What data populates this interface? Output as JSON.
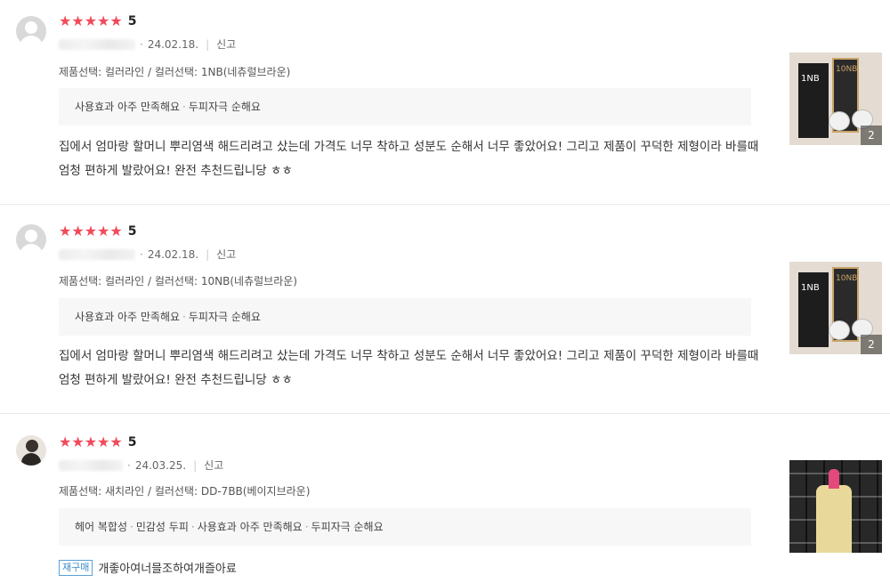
{
  "reviews": [
    {
      "stars": "★★★★★",
      "score": "5",
      "date": "24.02.18.",
      "report": "신고",
      "option": "제품선택: 컬러라인 / 컬러선택: 1NB(네츄럴브라운)",
      "tags": [
        "사용효과 아주 만족해요",
        "두피자극 순해요"
      ],
      "text": "집에서 엄마랑 할머니 뿌리염색 해드리려고 샀는데 가격도 너무 착하고 성분도 순해서 너무 좋았어요! 그리고 제품이 꾸덕한 제형이라 바를때 엄청 편하게 발랐어요! 완전 추천드립니당 ㅎㅎ",
      "photo_count": "2",
      "photo_labels": [
        "1NB",
        "10NB"
      ]
    },
    {
      "stars": "★★★★★",
      "score": "5",
      "date": "24.02.18.",
      "report": "신고",
      "option": "제품선택: 컬러라인 / 컬러선택: 10NB(네츄럴브라운)",
      "tags": [
        "사용효과 아주 만족해요",
        "두피자극 순해요"
      ],
      "text": "집에서 엄마랑 할머니 뿌리염색 해드리려고 샀는데 가격도 너무 착하고 성분도 순해서 너무 좋았어요! 그리고 제품이 꾸덕한 제형이라 바를때 엄청 편하게 발랐어요! 완전 추천드립니당 ㅎㅎ",
      "photo_count": "2",
      "photo_labels": [
        "1NB",
        "10NB"
      ]
    },
    {
      "stars": "★★★★★",
      "score": "5",
      "date": "24.03.25.",
      "report": "신고",
      "option": "제품선택: 새치라인 / 컬러선택: DD-7BB(베이지브라운)",
      "tags": [
        "헤어 복합성",
        "민감성 두피",
        "사용효과 아주 만족해요",
        "두피자극 순해요"
      ],
      "repurchase": "재구매",
      "text": "개좋아여너믈조하여개즐아료"
    }
  ],
  "colors": {
    "star": "#f24a5a",
    "badge": "#3b8bc8",
    "tag_bg": "#f7f7f7"
  }
}
